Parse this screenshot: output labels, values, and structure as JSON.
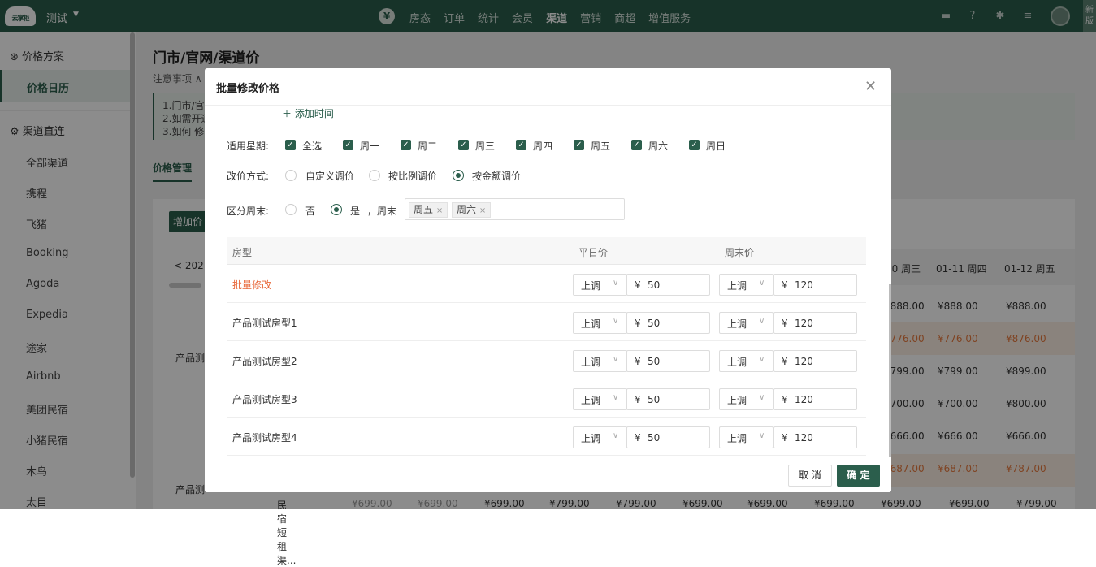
{
  "topbar": {
    "logo": "云掌柜",
    "store": "测试",
    "nav": [
      "房态",
      "订单",
      "统计",
      "会员",
      "渠道",
      "营销",
      "商超",
      "增值服务"
    ],
    "active_nav": "渠道",
    "newver": "新版",
    "icons": [
      "chat-icon",
      "help-icon",
      "gear-icon",
      "menu-icon",
      "user-icon"
    ]
  },
  "sidebar": {
    "group1": "价格方案",
    "active": "价格日历",
    "group2": "渠道直连",
    "items": [
      "全部渠道",
      "携程",
      "飞猪",
      "Booking",
      "Agoda",
      "Expedia",
      "途家",
      "Airbnb",
      "美团民宿",
      "小猪民宿",
      "木鸟",
      "太目"
    ]
  },
  "page": {
    "title": "门市/官网/渠道价",
    "notice": "注意事项 ∧",
    "notice_lines": [
      "1.门市/官网",
      "2.如需开通",
      "3.如何 修改"
    ],
    "tab": "价格管理",
    "add_button": "增加价",
    "date_prev": "<  202",
    "product_a": "产品测",
    "product_b": "产品测",
    "calendar_headers": [
      "10 周三",
      "01-11 周四",
      "01-12 周五"
    ],
    "calendar_rows": [
      [
        "¥888.00",
        "¥888.00",
        "¥888.00"
      ],
      [
        "¥776.00",
        "¥776.00",
        "¥876.00"
      ],
      [
        "¥799.00",
        "¥799.00",
        "¥899.00"
      ],
      [
        "¥700.00",
        "¥700.00",
        "¥800.00"
      ],
      [
        "¥666.00",
        "¥666.00",
        "¥666.00"
      ],
      [
        "¥687.00",
        "¥687.00",
        "¥787.00"
      ]
    ],
    "bottom_row": [
      "民宿短租渠...",
      "¥699.00",
      "¥699.00",
      "¥699.00",
      "¥799.00",
      "¥799.00",
      "¥699.00",
      "¥699.00",
      "¥699.00",
      "¥699.00",
      "¥699.00",
      "¥799.00"
    ]
  },
  "dialog": {
    "title": "批量修改价格",
    "add_time": "＋ 添加时间",
    "weekday_label": "适用星期:",
    "weekdays": [
      "全选",
      "周一",
      "周二",
      "周三",
      "周四",
      "周五",
      "周六",
      "周日"
    ],
    "method_label": "改价方式:",
    "methods": [
      "自定义调价",
      "按比例调价",
      "按金额调价"
    ],
    "selected_method": "按金额调价",
    "weekend_label": "区分周末:",
    "weekend_no": "否",
    "weekend_yes": "是",
    "weekend_text": "，周末",
    "weekend_tags": [
      "周五",
      "周六"
    ],
    "columns": [
      "房型",
      "平日价",
      "周末价"
    ],
    "rows": [
      {
        "name": "批量修改",
        "wd_mode": "上调",
        "wd_val": "50",
        "we_mode": "上调",
        "we_val": "120"
      },
      {
        "name": "产品测试房型1",
        "wd_mode": "上调",
        "wd_val": "50",
        "we_mode": "上调",
        "we_val": "120"
      },
      {
        "name": "产品测试房型2",
        "wd_mode": "上调",
        "wd_val": "50",
        "we_mode": "上调",
        "we_val": "120"
      },
      {
        "name": "产品测试房型3",
        "wd_mode": "上调",
        "wd_val": "50",
        "we_mode": "上调",
        "we_val": "120"
      },
      {
        "name": "产品测试房型4",
        "wd_mode": "上调",
        "wd_val": "50",
        "we_mode": "上调",
        "we_val": "120"
      }
    ],
    "currency": "¥",
    "cancel": "取 消",
    "ok": "确 定"
  },
  "colors": {
    "brand": "#2b5e4c",
    "accent_orange": "#e8683a"
  }
}
